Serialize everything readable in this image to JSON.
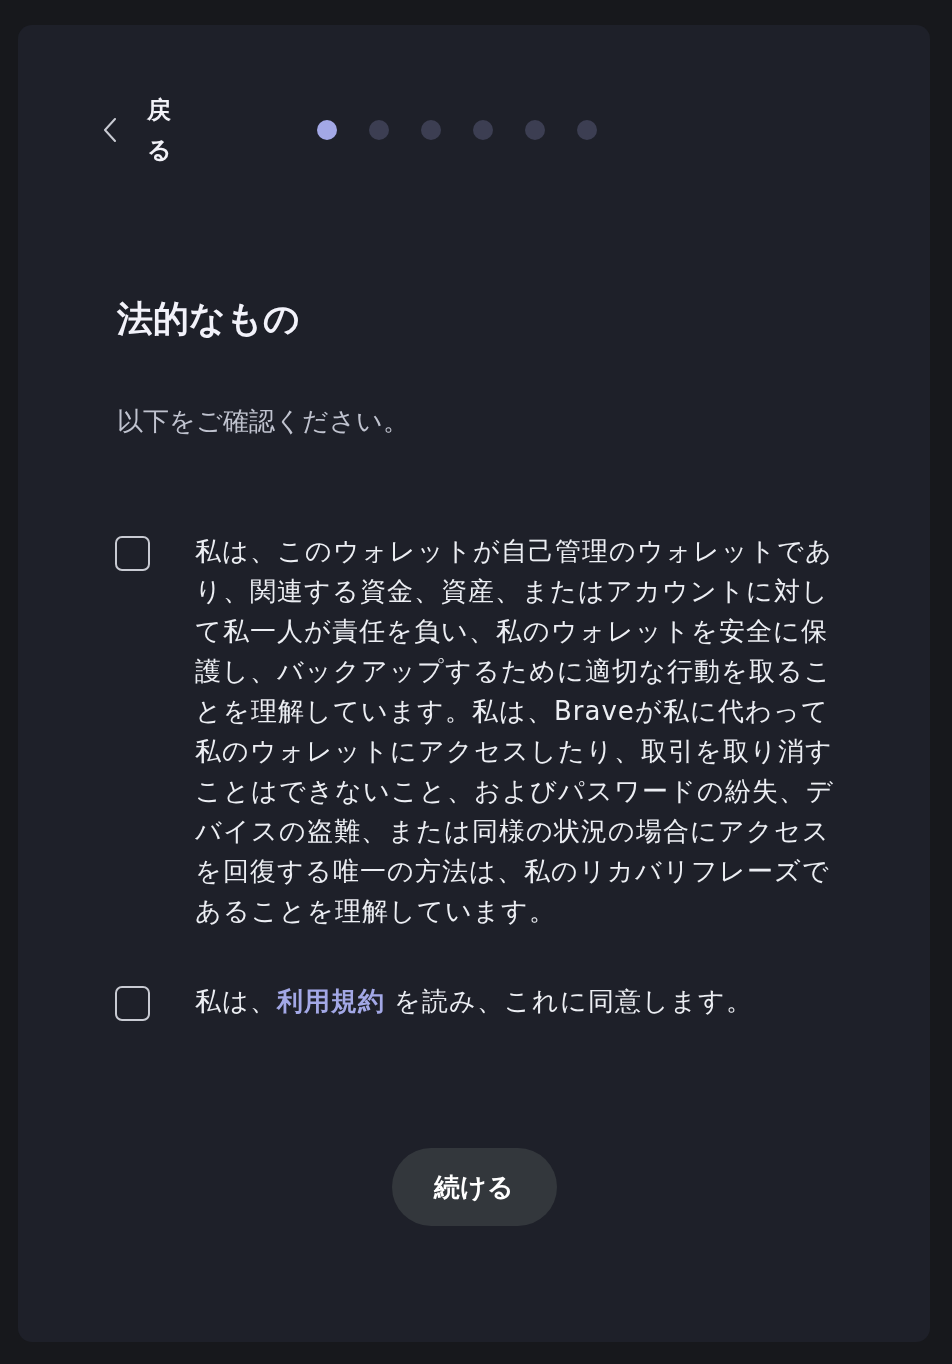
{
  "back_button": {
    "label": "戻る"
  },
  "steps": [
    {
      "selected": true
    },
    {
      "selected": false
    },
    {
      "selected": false
    },
    {
      "selected": false
    },
    {
      "selected": false
    },
    {
      "selected": false
    }
  ],
  "title": "法的なもの",
  "subtitle": "以下をご確認ください。",
  "agreements": [
    {
      "checked": false,
      "parts": [
        {
          "kind": "text",
          "text": "私は、このウォレットが自己管理のウォレットであり、関連する資金、資産、またはアカウントに対して私一人が責任を負い、私のウォレットを安全に保護し、バックアップするために適切な行動を取ることを理解しています。私は、Braveが私に代わって私のウォレットにアクセスしたり、取引を取り消すことはできないこと、およびパスワードの紛失、デバイスの盗難、または同様の状況の場合にアクセスを回復する唯一の方法は、私のリカバリフレーズであることを理解しています。"
        }
      ]
    },
    {
      "checked": false,
      "parts": [
        {
          "kind": "text",
          "text": "私は、"
        },
        {
          "kind": "link",
          "text": "利用規約"
        },
        {
          "kind": "text",
          "text": " を読み、これに同意します。"
        }
      ]
    }
  ],
  "continue_button": {
    "label": "続ける"
  }
}
